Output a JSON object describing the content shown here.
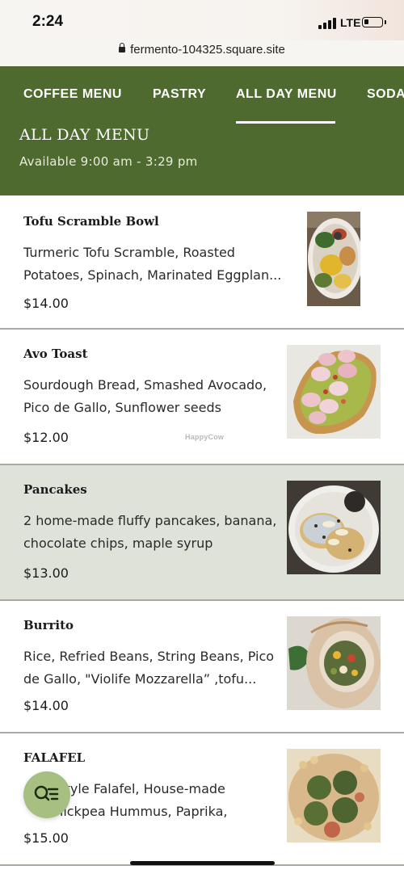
{
  "status_bar": {
    "time": "2:24",
    "network": "LTE"
  },
  "browser": {
    "url": "fermento-104325.square.site"
  },
  "tabs": [
    {
      "label": "COFFEE MENU"
    },
    {
      "label": "PASTRY"
    },
    {
      "label": "ALL DAY MENU",
      "active": true
    },
    {
      "label": "SODA"
    }
  ],
  "section": {
    "title": "ALL DAY MENU",
    "availability": "Available 9:00 am - 3:29 pm"
  },
  "items": [
    {
      "name": "Tofu Scramble Bowl",
      "description": "Turmeric Tofu Scramble, Roasted Potatoes, Spinach, Marinated Eggplan...",
      "price": "$14.00",
      "image": "tofu-scramble-bowl-photo"
    },
    {
      "name": "Avo Toast",
      "description": "Sourdough Bread, Smashed Avocado, Pico de Gallo, Sunflower seeds",
      "price": "$12.00",
      "image": "avo-toast-photo"
    },
    {
      "name": "Pancakes",
      "description": "2 home-made fluffy pancakes, banana, chocolate chips, maple syrup",
      "price": "$13.00",
      "image": "pancakes-photo"
    },
    {
      "name": "Burrito",
      "description": "Rice, Refried Beans, String Beans, Pico de Gallo, \"Violife Mozzarella” ,tofu...",
      "price": "$14.00",
      "image": "burrito-photo"
    },
    {
      "name": "FALAFEL",
      "description": "...style Falafel, House-made Chickpea Hummus, Paprika, Toasted...",
      "price": "$15.00",
      "image": "falafel-photo"
    }
  ],
  "watermark": "HappyCow",
  "floating_button": {
    "icon": "search-list-icon"
  },
  "colors": {
    "brand_green": "#4f6a2f",
    "highlight_row": "#dfe2d9",
    "fab": "#a7bf80"
  }
}
